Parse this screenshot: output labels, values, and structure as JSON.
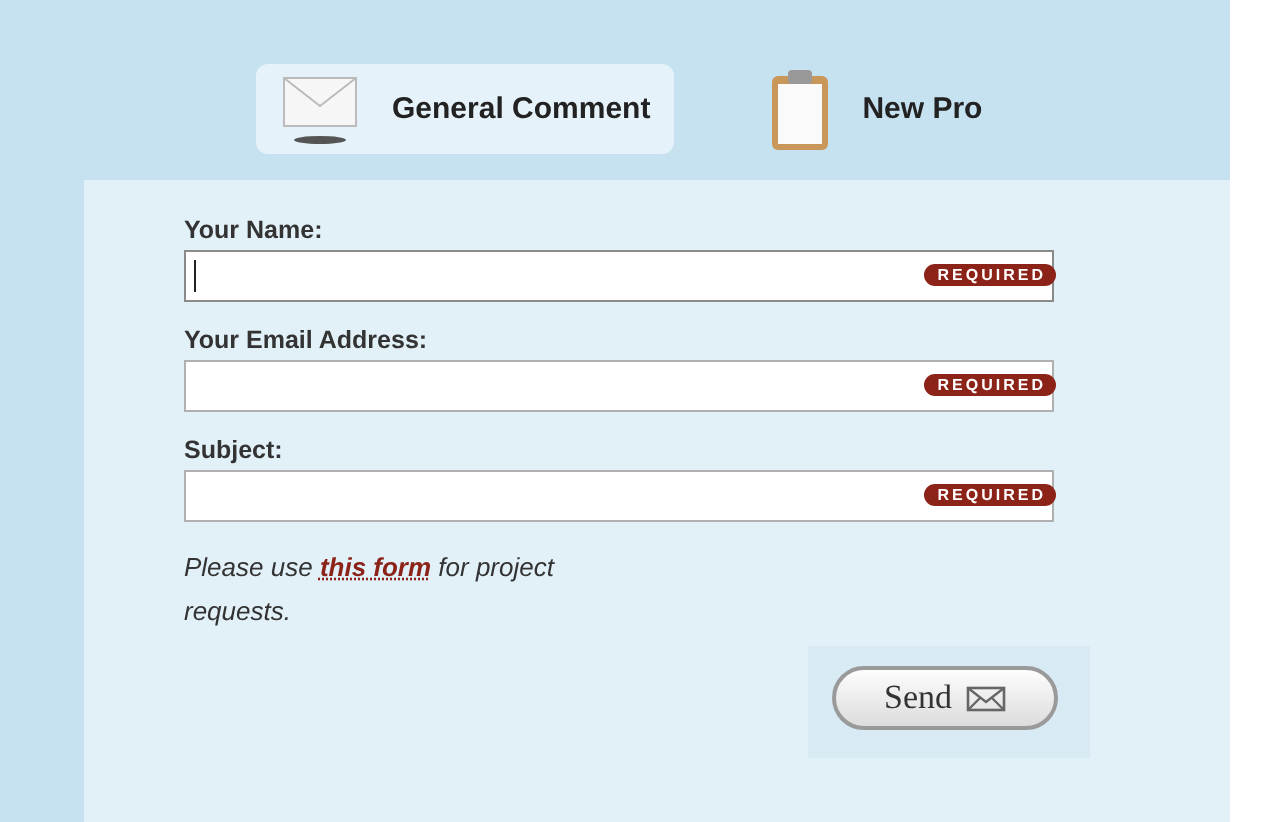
{
  "tabs": [
    {
      "label": "General Comment",
      "kind": "envelope",
      "selected": true
    },
    {
      "label": "New Pro",
      "kind": "clipboard",
      "selected": false
    }
  ],
  "fields": [
    {
      "label": "Your Name:",
      "badge": "REQUIRED",
      "focused": true
    },
    {
      "label": "Your Email Address:",
      "badge": "REQUIRED",
      "focused": false
    },
    {
      "label": "Subject:",
      "badge": "REQUIRED",
      "focused": false
    }
  ],
  "note": {
    "before": "Please use ",
    "link": "this form",
    "after": " for project requests."
  },
  "send_button": {
    "label": "Send"
  }
}
